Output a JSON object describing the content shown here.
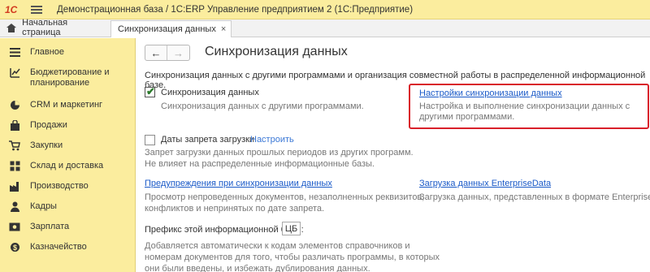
{
  "window": {
    "title": "Демонстрационная база / 1С:ERP Управление предприятием 2  (1С:Предприятие)",
    "logo": "1С"
  },
  "tabs": {
    "home": "Начальная страница",
    "active": "Синхронизация данных",
    "close": "×"
  },
  "sidebar": {
    "items": [
      {
        "label": "Главное",
        "icon": "menu-lines-icon"
      },
      {
        "label": "Бюджетирование и планирование",
        "icon": "chart-icon"
      },
      {
        "label": "CRM и маркетинг",
        "icon": "pie-icon"
      },
      {
        "label": "Продажи",
        "icon": "bag-icon"
      },
      {
        "label": "Закупки",
        "icon": "cart-icon"
      },
      {
        "label": "Склад и доставка",
        "icon": "warehouse-icon"
      },
      {
        "label": "Производство",
        "icon": "factory-icon"
      },
      {
        "label": "Кадры",
        "icon": "person-icon"
      },
      {
        "label": "Зарплата",
        "icon": "money-icon"
      },
      {
        "label": "Казначейство",
        "icon": "treasury-icon"
      }
    ]
  },
  "main": {
    "nav": {
      "back": "←",
      "forward": "→"
    },
    "title": "Синхронизация данных",
    "intro": "Синхронизация данных с другими программами и организация совместной работы в распределенной информационной базе.",
    "sync_checkbox": {
      "label": "Синхронизация данных",
      "description": "Синхронизация данных с другими программами.",
      "checked": true
    },
    "settings_link": {
      "label": "Настройки синхронизации данных",
      "description": "Настройка и выполнение синхронизации данных с другими программами."
    },
    "ban_dates": {
      "label": "Даты запрета загрузки",
      "configure": "Настроить",
      "description_line1": "Запрет загрузки данных прошлых периодов из других программ.",
      "description_line2": "Не влияет на распределенные информационные базы.",
      "checked": false
    },
    "warnings": {
      "label": "Предупреждения при синхронизации данных",
      "description_line1": "Просмотр непроведенных документов, незаполненных реквизитов,",
      "description_line2": "конфликтов и непринятых по дате запрета."
    },
    "enterprise_data": {
      "label": "Загрузка данных EnterpriseData",
      "description": "Загрузка данных, представленных в формате EnterpriseData."
    },
    "prefix": {
      "label": "Префикс этой информационной базы:",
      "value": "ЦБ",
      "description_line1": "Добавляется автоматически к кодам элементов справочников и",
      "description_line2": "номерам документов для того, чтобы различать программы, в которых",
      "description_line3": "они были введены, и избежать дублирования данных."
    }
  }
}
